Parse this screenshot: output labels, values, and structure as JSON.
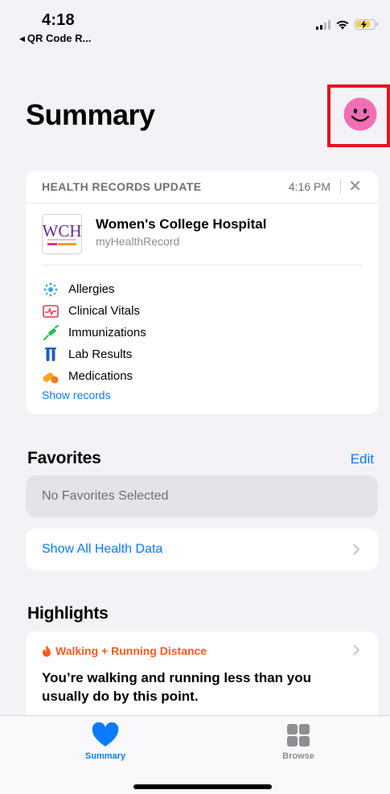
{
  "status_bar": {
    "time": "4:18",
    "back_app_label": "QR Code R..."
  },
  "header": {
    "title": "Summary"
  },
  "health_records": {
    "header_label": "HEALTH RECORDS UPDATE",
    "time": "4:16 PM",
    "logo_text": "WCH",
    "organization": "Women's College Hospital",
    "source": "myHealthRecord",
    "items": [
      {
        "label": "Allergies",
        "icon": "allergies-icon"
      },
      {
        "label": "Clinical Vitals",
        "icon": "clinical-vitals-icon"
      },
      {
        "label": "Immunizations",
        "icon": "immunizations-icon"
      },
      {
        "label": "Lab Results",
        "icon": "lab-results-icon"
      },
      {
        "label": "Medications",
        "icon": "medications-icon"
      }
    ],
    "show_records_label": "Show records"
  },
  "favorites": {
    "title": "Favorites",
    "edit_label": "Edit",
    "empty_label": "No Favorites Selected",
    "show_all_label": "Show All Health Data"
  },
  "highlights": {
    "title": "Highlights",
    "category": "Walking + Running Distance",
    "message": "You’re walking and running less than you usually do by this point."
  },
  "tab_bar": {
    "summary_label": "Summary",
    "browse_label": "Browse"
  },
  "colors": {
    "accent": "#0a7aff",
    "highlight_orange": "#ff5a1f",
    "avatar_pink": "#f06fb4",
    "annotation_red": "#e8121b"
  }
}
